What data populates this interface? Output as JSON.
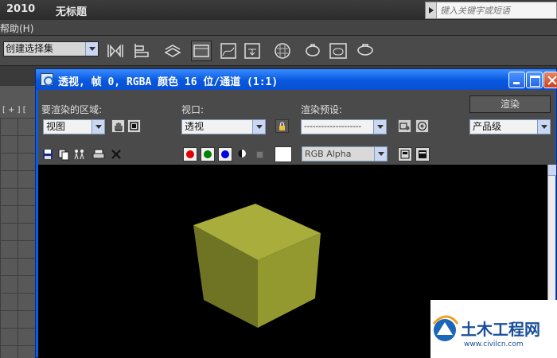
{
  "app": {
    "version": "2010",
    "document_title": "无标题",
    "search_placeholder": "键入关键字或短语"
  },
  "menu": {
    "help_label": "帮助(H)"
  },
  "toolbar": {
    "selection_set_value": "创建选择集"
  },
  "render_window": {
    "title": "透视, 帧 0, RGBA 颜色 16 位/通道 (1:1)",
    "area_label": "要渲染的区域:",
    "area_value": "视图",
    "viewport_label": "视口:",
    "viewport_value": "透视",
    "preset_label": "渲染预设:",
    "preset_value": "--------------------",
    "render_button": "渲染",
    "quality_value": "产品级",
    "channel_value": "RGB Alpha"
  },
  "viewport": {
    "corner_label": "[ + ] ["
  },
  "scene": {
    "cube_color": "#a8ad3c"
  },
  "colors": {
    "title_blue": "#0758e0",
    "red_channel": "#e00000",
    "green_channel": "#008000",
    "blue_channel": "#0000e0"
  },
  "watermark": {
    "site_name": "土木工程网",
    "url": "www.civilcn.com"
  }
}
